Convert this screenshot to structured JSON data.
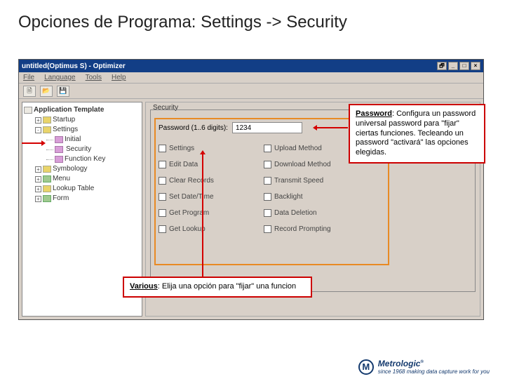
{
  "slide": {
    "title": "Opciones de Programa: Settings -> Security"
  },
  "window": {
    "title": "untitled(Optimus S) - Optimizer",
    "menu": {
      "file": "File",
      "language": "Language",
      "tools": "Tools",
      "help": "Help"
    },
    "toolbar_icons": {
      "new": "new-file",
      "open": "open-folder",
      "save": "save-disk"
    }
  },
  "tree": {
    "root": "Application Template",
    "items": [
      {
        "label": "Startup",
        "folder": "y"
      },
      {
        "label": "Settings",
        "folder": "y",
        "open": true,
        "children": [
          {
            "label": "Initial",
            "folder": "p"
          },
          {
            "label": "Security",
            "folder": "p",
            "selected": true
          },
          {
            "label": "Function Key",
            "folder": "p"
          }
        ]
      },
      {
        "label": "Symbology",
        "folder": "y"
      },
      {
        "label": "Menu",
        "folder": "g"
      },
      {
        "label": "Lookup Table",
        "folder": "y"
      },
      {
        "label": "Form",
        "folder": "g"
      }
    ]
  },
  "panel": {
    "group_label": "Security",
    "password_label": "Password (1..6 digits):",
    "password_value": "1234",
    "options": [
      {
        "label": "Settings"
      },
      {
        "label": "Upload Method"
      },
      {
        "label": "Edit Data"
      },
      {
        "label": "Download Method"
      },
      {
        "label": "Clear Records"
      },
      {
        "label": "Transmit Speed"
      },
      {
        "label": "Set Date/Time"
      },
      {
        "label": "Backlight"
      },
      {
        "label": "Get Program"
      },
      {
        "label": "Data Deletion"
      },
      {
        "label": "Get Lookup"
      },
      {
        "label": "Record Prompting"
      }
    ]
  },
  "callouts": {
    "password": {
      "heading": "Password",
      "text": ":  Configura un password universal password para \"fijar\" ciertas funciones. Tecleando un password \"activará\" las opciones elegidas."
    },
    "various": {
      "heading": "Various",
      "text": ":  Elija una opción para \"fijar\" una funcion"
    }
  },
  "brand": {
    "name": "Metrologic",
    "tagline": "since 1968 making data capture work for you"
  }
}
